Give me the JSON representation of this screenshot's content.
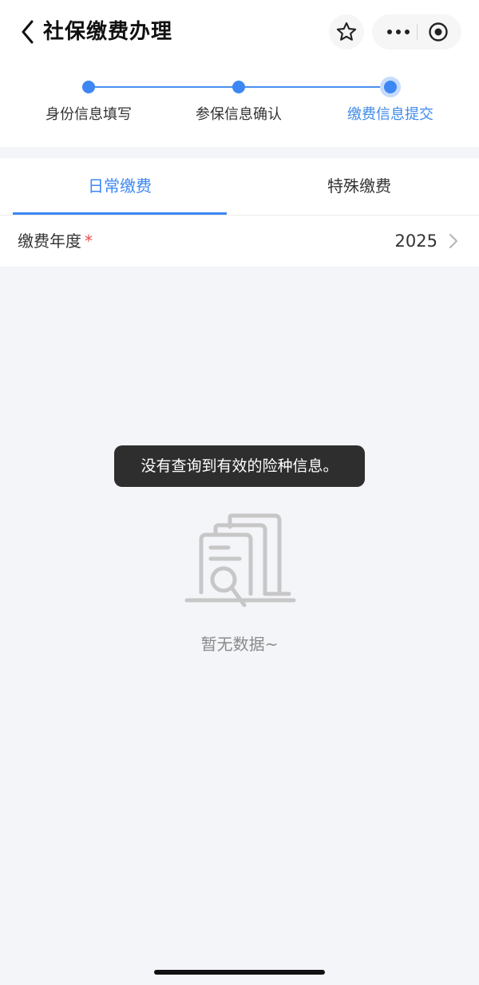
{
  "nav": {
    "title": "社保缴费办理"
  },
  "icons": {
    "back": "chevron-left-icon",
    "favorite": "star-icon",
    "more": "more-dots-icon",
    "close": "target-circle-icon"
  },
  "stepper": {
    "steps": [
      {
        "label": "身份信息填写",
        "state": "done"
      },
      {
        "label": "参保信息确认",
        "state": "done"
      },
      {
        "label": "缴费信息提交",
        "state": "active"
      }
    ],
    "accent_color": "#3d87f3"
  },
  "tabs": {
    "items": [
      {
        "label": "日常缴费",
        "selected": true
      },
      {
        "label": "特殊缴费",
        "selected": false
      }
    ]
  },
  "form": {
    "year_label": "缴费年度",
    "required_mark": "*",
    "year_value": "2025"
  },
  "toast": {
    "message": "没有查询到有效的险种信息。"
  },
  "empty_state": {
    "text": "暂无数据~"
  }
}
